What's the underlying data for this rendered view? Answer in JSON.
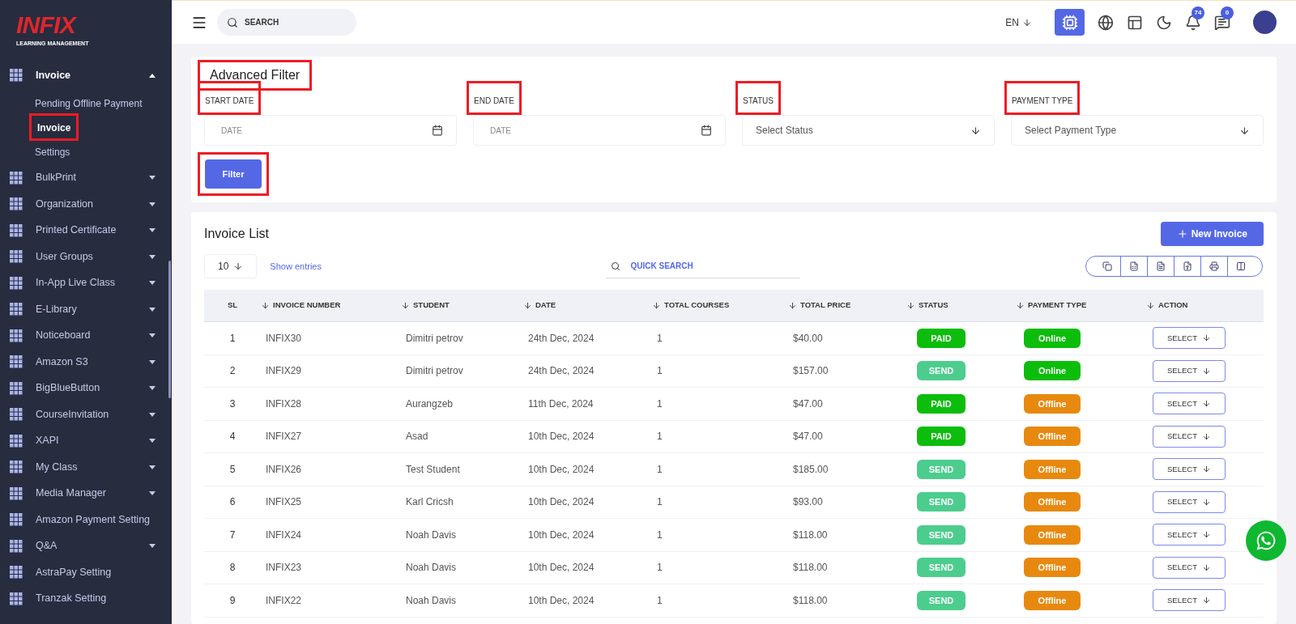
{
  "sidebar": {
    "logo": {
      "brand": "INFIX",
      "tagline": "LEARNING MANAGEMENT"
    },
    "items": [
      {
        "label": "Invoice",
        "kind": "group",
        "expanded": true,
        "children": [
          {
            "label": "Pending Offline Payment",
            "selected": false,
            "highlighted": false
          },
          {
            "label": "Invoice",
            "selected": true,
            "highlighted": true
          },
          {
            "label": "Settings",
            "selected": false,
            "highlighted": false
          }
        ]
      },
      {
        "label": "BulkPrint",
        "kind": "group",
        "expanded": false
      },
      {
        "label": "Organization",
        "kind": "group",
        "expanded": false
      },
      {
        "label": "Printed Certificate",
        "kind": "group",
        "expanded": false
      },
      {
        "label": "User Groups",
        "kind": "group",
        "expanded": false
      },
      {
        "label": "In-App Live Class",
        "kind": "group",
        "expanded": false
      },
      {
        "label": "E-Library",
        "kind": "group",
        "expanded": false
      },
      {
        "label": "Noticeboard",
        "kind": "group",
        "expanded": false
      },
      {
        "label": "Amazon S3",
        "kind": "group",
        "expanded": false
      },
      {
        "label": "BigBlueButton",
        "kind": "group",
        "expanded": false
      },
      {
        "label": "CourseInvitation",
        "kind": "group",
        "expanded": false
      },
      {
        "label": "XAPI",
        "kind": "group",
        "expanded": false
      },
      {
        "label": "My Class",
        "kind": "group",
        "expanded": false
      },
      {
        "label": "Media Manager",
        "kind": "group",
        "expanded": false
      },
      {
        "label": "Amazon Payment Setting",
        "kind": "link"
      },
      {
        "label": "Q&A",
        "kind": "group",
        "expanded": false
      },
      {
        "label": "AstraPay Setting",
        "kind": "link"
      },
      {
        "label": "Tranzak Setting",
        "kind": "link"
      }
    ]
  },
  "header": {
    "search": {
      "placeholder": "SEARCH"
    },
    "language": "EN",
    "notifications": "74",
    "messages": "0"
  },
  "advanced_filter": {
    "title": "Advanced Filter",
    "title_highlighted": true,
    "fields": [
      {
        "label": "START DATE",
        "kind": "date",
        "placeholder": "DATE",
        "highlighted": true
      },
      {
        "label": "END DATE",
        "kind": "date",
        "placeholder": "DATE",
        "highlighted": true
      },
      {
        "label": "STATUS",
        "kind": "select",
        "placeholder": "Select Status",
        "highlighted": true
      },
      {
        "label": "PAYMENT TYPE",
        "kind": "select",
        "placeholder": "Select Payment Type",
        "highlighted": true
      }
    ],
    "button": {
      "label": "Filter",
      "highlighted": true
    }
  },
  "invoice_list": {
    "title": "Invoice List",
    "new_button": "New Invoice",
    "entries": "10",
    "entries_label": "Show entries",
    "quick_search": {
      "placeholder": "QUICK SEARCH"
    },
    "table": {
      "columns": [
        {
          "label": "SL",
          "sortable": false
        },
        {
          "label": "INVOICE NUMBER",
          "sortable": true
        },
        {
          "label": "STUDENT",
          "sortable": true
        },
        {
          "label": "DATE",
          "sortable": true
        },
        {
          "label": "TOTAL COURSES",
          "sortable": true
        },
        {
          "label": "TOTAL PRICE",
          "sortable": true
        },
        {
          "label": "STATUS",
          "sortable": true
        },
        {
          "label": "PAYMENT TYPE",
          "sortable": true
        },
        {
          "label": "ACTION",
          "sortable": true
        }
      ],
      "rows": [
        {
          "sl": "1",
          "invoice": "INFIX30",
          "student": "Dimitri petrov",
          "date": "24th Dec, 2024",
          "courses": "1",
          "price": "$40.00",
          "status": {
            "label": "PAID",
            "kind": "paid"
          },
          "payment": {
            "label": "Online",
            "kind": "online"
          },
          "action": "SELECT"
        },
        {
          "sl": "2",
          "invoice": "INFIX29",
          "student": "Dimitri petrov",
          "date": "24th Dec, 2024",
          "courses": "1",
          "price": "$157.00",
          "status": {
            "label": "SEND",
            "kind": "send"
          },
          "payment": {
            "label": "Online",
            "kind": "online"
          },
          "action": "SELECT"
        },
        {
          "sl": "3",
          "invoice": "INFIX28",
          "student": "Aurangzeb",
          "date": "11th Dec, 2024",
          "courses": "1",
          "price": "$47.00",
          "status": {
            "label": "PAID",
            "kind": "paid"
          },
          "payment": {
            "label": "Offline",
            "kind": "offline"
          },
          "action": "SELECT"
        },
        {
          "sl": "4",
          "invoice": "INFIX27",
          "student": "Asad",
          "date": "10th Dec, 2024",
          "courses": "1",
          "price": "$47.00",
          "status": {
            "label": "PAID",
            "kind": "paid"
          },
          "payment": {
            "label": "Offline",
            "kind": "offline"
          },
          "action": "SELECT"
        },
        {
          "sl": "5",
          "invoice": "INFIX26",
          "student": "Test Student",
          "date": "10th Dec, 2024",
          "courses": "1",
          "price": "$185.00",
          "status": {
            "label": "SEND",
            "kind": "send"
          },
          "payment": {
            "label": "Offline",
            "kind": "offline"
          },
          "action": "SELECT"
        },
        {
          "sl": "6",
          "invoice": "INFIX25",
          "student": "Karl Cricsh",
          "date": "10th Dec, 2024",
          "courses": "1",
          "price": "$93.00",
          "status": {
            "label": "SEND",
            "kind": "send"
          },
          "payment": {
            "label": "Offline",
            "kind": "offline"
          },
          "action": "SELECT"
        },
        {
          "sl": "7",
          "invoice": "INFIX24",
          "student": "Noah Davis",
          "date": "10th Dec, 2024",
          "courses": "1",
          "price": "$118.00",
          "status": {
            "label": "SEND",
            "kind": "send"
          },
          "payment": {
            "label": "Offline",
            "kind": "offline"
          },
          "action": "SELECT"
        },
        {
          "sl": "8",
          "invoice": "INFIX23",
          "student": "Noah Davis",
          "date": "10th Dec, 2024",
          "courses": "1",
          "price": "$118.00",
          "status": {
            "label": "SEND",
            "kind": "send"
          },
          "payment": {
            "label": "Offline",
            "kind": "offline"
          },
          "action": "SELECT"
        },
        {
          "sl": "9",
          "invoice": "INFIX22",
          "student": "Noah Davis",
          "date": "10th Dec, 2024",
          "courses": "1",
          "price": "$118.00",
          "status": {
            "label": "SEND",
            "kind": "send"
          },
          "payment": {
            "label": "Offline",
            "kind": "offline"
          },
          "action": "SELECT"
        }
      ]
    }
  }
}
